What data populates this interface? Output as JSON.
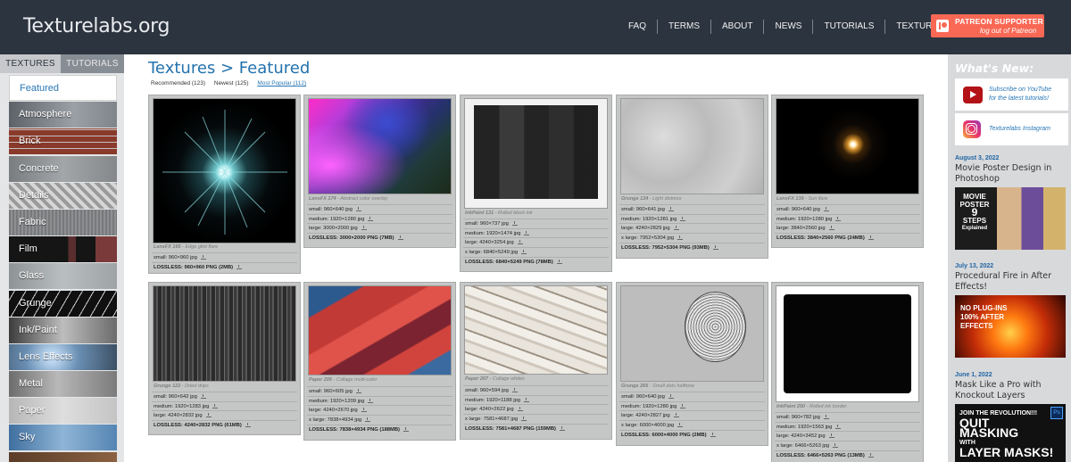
{
  "header": {
    "logo": "Texturelabs.org",
    "nav": [
      "FAQ",
      "TERMS",
      "ABOUT",
      "NEWS",
      "TUTORIALS",
      "TEXTURES"
    ],
    "patreon": {
      "title": "PATREON SUPPORTER",
      "logout": "log out of Patreon",
      "icon": "patreon-icon",
      "color": "#f96854"
    }
  },
  "sidebar": {
    "tabs": [
      "TEXTURES",
      "TUTORIALS"
    ],
    "categories": [
      {
        "label": "Featured",
        "selected": true
      },
      {
        "label": "Atmosphere"
      },
      {
        "label": "Brick"
      },
      {
        "label": "Concrete"
      },
      {
        "label": "Details"
      },
      {
        "label": "Fabric"
      },
      {
        "label": "Film"
      },
      {
        "label": "Glass"
      },
      {
        "label": "Grunge"
      },
      {
        "label": "Ink/Paint"
      },
      {
        "label": "Lens Effects"
      },
      {
        "label": "Metal"
      },
      {
        "label": "Paper"
      },
      {
        "label": "Sky"
      }
    ]
  },
  "main": {
    "title": "Textures > Featured",
    "sorts": [
      "Recommended (123)",
      "Newest (125)",
      "Most Popular (112)"
    ],
    "cards": [
      {
        "name": "LensFX 165",
        "desc": " - Edge glint flare",
        "sizes": [
          "small: 960×960 jpg"
        ],
        "lossless": "LOSSLESS: 960×960 PNG (2MB)"
      },
      {
        "name": "LensFX 174",
        "desc": " - Abstract color overlay",
        "sizes": [
          "small: 960×640 jpg",
          "medium: 1920×1280 jpg",
          "large: 3000×2000 jpg"
        ],
        "lossless": "LOSSLESS: 3000×2000 PNG (7MB)"
      },
      {
        "name": "InkPaint 131",
        "desc": " - Rolled block ink",
        "sizes": [
          "small: 960×737 jpg",
          "medium: 1920×1474 jpg",
          "large: 4240×3254 jpg",
          "x large: 6840×5249 jpg"
        ],
        "lossless": "LOSSLESS: 6840×5249 PNG (78MB)"
      },
      {
        "name": "Grunge 134",
        "desc": " - Light distress",
        "sizes": [
          "small: 960×641 jpg",
          "medium: 1920×1281 jpg",
          "large: 4240×2829 jpg",
          "x large: 7952×5304 jpg"
        ],
        "lossless": "LOSSLESS: 7952×5304 PNG (93MB)"
      },
      {
        "name": "LensFX 139",
        "desc": " - Sun flare",
        "sizes": [
          "small: 960×640 jpg",
          "medium: 1920×1280 jpg",
          "large: 3840×2560 jpg"
        ],
        "lossless": "LOSSLESS: 3840×2560 PNG (24MB)"
      },
      {
        "name": "Grunge 122",
        "desc": " - Dried drips",
        "sizes": [
          "small: 960×642 jpg",
          "medium: 1920×1283 jpg",
          "large: 4240×2832 jpg"
        ],
        "lossless": "LOSSLESS: 4240×2832 PNG (61MB)"
      },
      {
        "name": "Paper 205",
        "desc": " - Collage multi-color",
        "sizes": [
          "small: 960×605 jpg",
          "medium: 1920×1209 jpg",
          "large: 4240×2670 jpg",
          "x large: 7838×4934 jpg"
        ],
        "lossless": "LOSSLESS: 7838×4934 PNG (188MB)"
      },
      {
        "name": "Paper 207",
        "desc": " - Collage whites",
        "sizes": [
          "small: 960×594 jpg",
          "medium: 1920×1188 jpg",
          "large: 4240×2622 jpg",
          "x large: 7581×4687 jpg"
        ],
        "lossless": "LOSSLESS: 7581×4687 PNG (159MB)"
      },
      {
        "name": "Grunge 265",
        "desc": " - Small dots halftone",
        "sizes": [
          "small: 960×640 jpg",
          "medium: 1920×1280 jpg",
          "large: 4240×2827 jpg",
          "x large: 6000×4000 jpg"
        ],
        "lossless": "LOSSLESS: 6000×4000 PNG (2MB)"
      },
      {
        "name": "InkPaint 250",
        "desc": " - Rolled ink border",
        "sizes": [
          "small: 960×782 jpg",
          "medium: 1920×1563 jpg",
          "large: 4240×3452 jpg",
          "x large: 6466×5263 jpg"
        ],
        "lossless": "LOSSLESS: 6466×5263 PNG (13MB)"
      }
    ]
  },
  "right": {
    "title": "What's New:",
    "youtube": {
      "line1": "Subscribe on YouTube",
      "line2": "for the latest tutorials!",
      "icon": "youtube-icon"
    },
    "instagram": {
      "label": "Texturelabs Instagram",
      "icon": "instagram-icon"
    },
    "posts": [
      {
        "date": "August 3, 2022",
        "title": "Movie Poster Design in Photoshop",
        "img_text": [
          "MOVIE",
          "POSTER",
          "9",
          "STEPS",
          "Explained"
        ]
      },
      {
        "date": "July 13, 2022",
        "title": "Procedural Fire in After Effects!",
        "img_text": [
          "NO PLUG-INS",
          "100% AFTER",
          "EFFECTS"
        ]
      },
      {
        "date": "June 1, 2022",
        "title": "Mask Like a Pro with Knockout Layers",
        "img_text": [
          "JOIN THE REVOLUTION!!!",
          "QUIT",
          "MASKING",
          "WITH",
          "LAYER MASKS!"
        ]
      }
    ]
  }
}
